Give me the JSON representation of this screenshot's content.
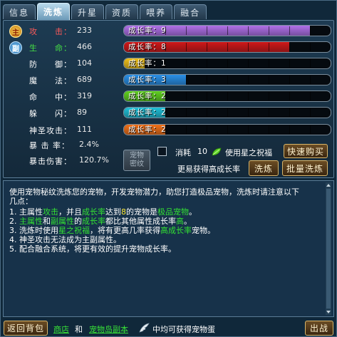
{
  "tabs": [
    {
      "label": "信息",
      "active": false
    },
    {
      "label": "洗炼",
      "active": true
    },
    {
      "label": "升星",
      "active": false
    },
    {
      "label": "资质",
      "active": false
    },
    {
      "label": "喂养",
      "active": false
    },
    {
      "label": "融合",
      "active": false
    }
  ],
  "badges": {
    "main": "主",
    "sub": "副"
  },
  "stats": [
    {
      "label": "攻　　击：",
      "value": "233",
      "color": "#ff5a5a",
      "bar_text": "成长率：9",
      "level": 9,
      "bar_color": "#b070e8",
      "badge": "main"
    },
    {
      "label": "生　　命：",
      "value": "466",
      "color": "#45e045",
      "bar_text": "成长率：8",
      "level": 8,
      "bar_color": "#d01818",
      "badge": "sub"
    },
    {
      "label": "防　　御：",
      "value": "104",
      "color": "#ffffff",
      "bar_text": "成长率：1",
      "level": 1,
      "bar_color": "#f0c01a"
    },
    {
      "label": "魔　　法：",
      "value": "689",
      "color": "#ffffff",
      "bar_text": "成长率：3",
      "level": 3,
      "bar_color": "#2a90e8"
    },
    {
      "label": "命　　中：",
      "value": "319",
      "color": "#ffffff",
      "bar_text": "成长率：2",
      "level": 2,
      "bar_color": "#60d020"
    },
    {
      "label": "躲　　闪：",
      "value": "89",
      "color": "#ffffff",
      "bar_text": "成长率：2",
      "level": 2,
      "bar_color": "#20c0d8"
    },
    {
      "label": "神圣攻击：",
      "value": "111",
      "color": "#ffffff",
      "bar_text": "成长率：2",
      "level": 2,
      "bar_color": "#f07018"
    },
    {
      "label": "暴 击 率：",
      "value": "2.4%",
      "color": "#ffffff"
    },
    {
      "label": "暴击伤害：",
      "value": "120.7%",
      "color": "#ffffff"
    }
  ],
  "bar_max": 10,
  "controls": {
    "pet_button": "宠物\n密纹",
    "consume_label": "消耗",
    "consume_count": "10",
    "use_blessing": "使用星之祝福",
    "hint": "更易获得高成长率",
    "quick_buy": "快速购买",
    "refine": "洗炼",
    "batch_refine": "批量洗炼"
  },
  "info": {
    "line1": "使用宠物秘纹洗炼您的宠物，开发宠物潜力，助您打造极品宠物，洗炼时请注意以下",
    "line2": "几点：",
    "l3a": "1. 主属性",
    "l3b": "攻击",
    "l3c": "，并且",
    "l3d": "成长率",
    "l3e": "达到",
    "l3f": "8",
    "l3g": "的宠物是",
    "l3h": "极品宠物",
    "l3i": "。",
    "l4a": "2. ",
    "l4b": "主属性",
    "l4c": "和",
    "l4d": "副属性",
    "l4e": "的",
    "l4f": "成长率",
    "l4g": "都比其他属性成长率",
    "l4h": "高",
    "l4i": "。",
    "l5a": "3. 洗炼时使用",
    "l5b": "星之祝福",
    "l5c": "，将有更高几率获得",
    "l5d": "高成长率",
    "l5e": "宠物。",
    "l6": "4. 神圣攻击无法成为主副属性。",
    "l7": "5. 配合融合系统，将更有效的提升宠物成长率。"
  },
  "footer": {
    "back": "返回背包",
    "shop": "商店",
    "and": "和",
    "dungeon": "宠物岛副本",
    "tip": "中均可获得宠物蛋",
    "exit": "出战"
  }
}
